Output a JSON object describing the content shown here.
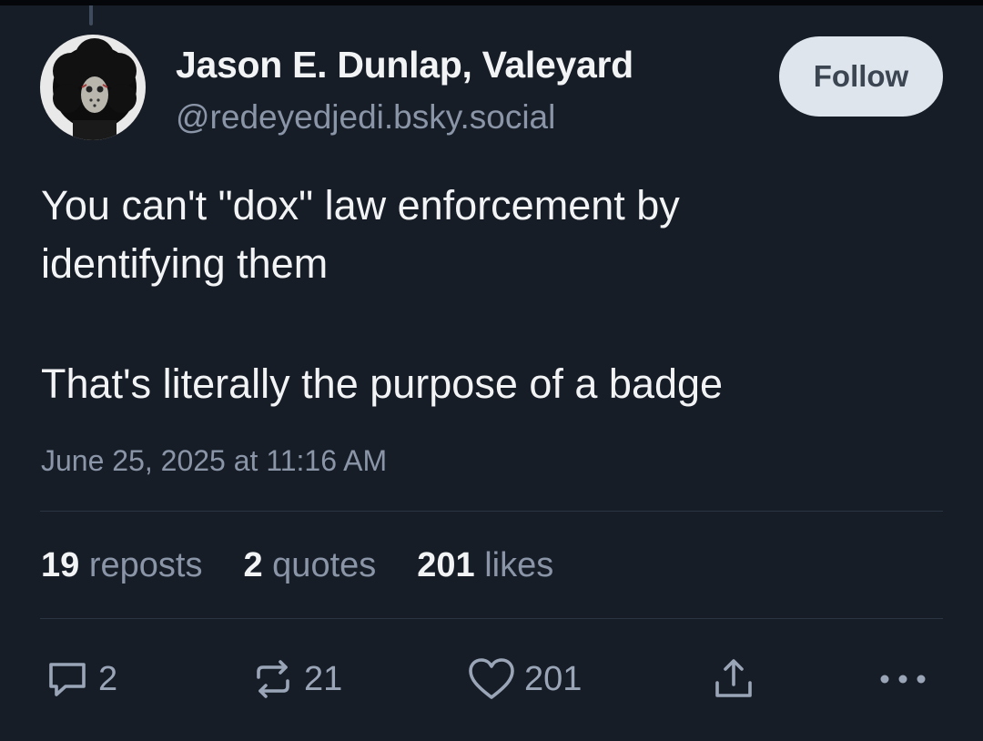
{
  "author": {
    "name": "Jason E. Dunlap, Valeyard",
    "handle": "@redeyedjedi.bsky.social"
  },
  "follow_button": {
    "label": "Follow"
  },
  "post": {
    "lines": [
      "You can't \"dox\" law enforcement by",
      "identifying them",
      "That's literally the purpose of a badge"
    ],
    "timestamp": "June 25, 2025 at 11:16 AM"
  },
  "stats": {
    "reposts_count": "19",
    "reposts_label": "reposts",
    "quotes_count": "2",
    "quotes_label": "quotes",
    "likes_count": "201",
    "likes_label": "likes"
  },
  "actions": {
    "reply": {
      "icon": "reply-icon",
      "count": "2"
    },
    "repost": {
      "icon": "repost-icon",
      "count": "21"
    },
    "like": {
      "icon": "heart-icon",
      "count": "201"
    },
    "share": {
      "icon": "share-icon"
    },
    "more": {
      "icon": "more-icon"
    }
  },
  "colors": {
    "background": "#171d27",
    "text_primary": "#f1f3f5",
    "text_secondary": "#8a96a8",
    "follow_button_bg": "#dfe5ec",
    "divider": "#2b3442"
  }
}
